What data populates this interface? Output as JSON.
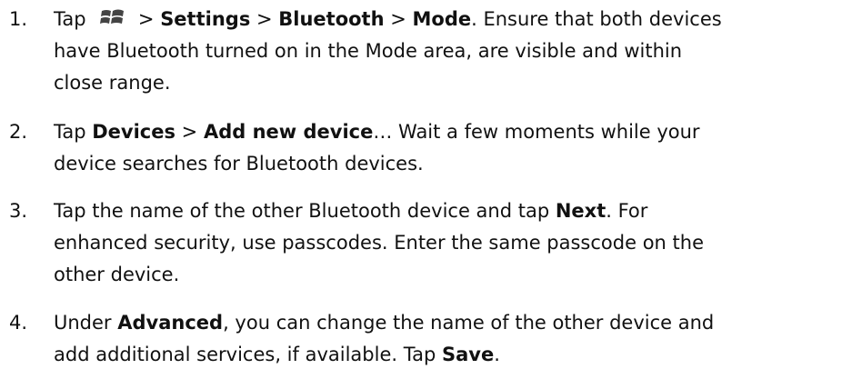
{
  "steps": [
    {
      "number": "1.",
      "lines": [
        [
          "Tap ",
          "windows-icon",
          " > ",
          "**Settings",
          " > ",
          "**Bluetooth",
          " > ",
          "**Mode",
          ". Ensure that both devices"
        ],
        [
          "have Bluetooth turned on in the Mode area, are visible and within"
        ],
        [
          "close range."
        ]
      ]
    },
    {
      "number": "2.",
      "lines": [
        [
          "Tap ",
          "**Devices",
          " > ",
          "**Add new device",
          "… Wait a few moments while your"
        ],
        [
          "device searches for Bluetooth devices."
        ]
      ]
    },
    {
      "number": "3.",
      "lines": [
        [
          "Tap the name of the other Bluetooth device and tap ",
          "**Next",
          ". For"
        ],
        [
          "enhanced security, use passcodes. Enter the same passcode on the"
        ],
        [
          "other device."
        ]
      ]
    },
    {
      "number": "4.",
      "lines": [
        [
          "Under ",
          "**Advanced",
          ", you can change the name of the other device and"
        ],
        [
          "add additional services, if available. Tap ",
          "**Save",
          "."
        ]
      ]
    }
  ],
  "icons": {
    "start": "windows-flag-icon"
  },
  "colors": {
    "text": "#111111",
    "icon": "#444444"
  }
}
